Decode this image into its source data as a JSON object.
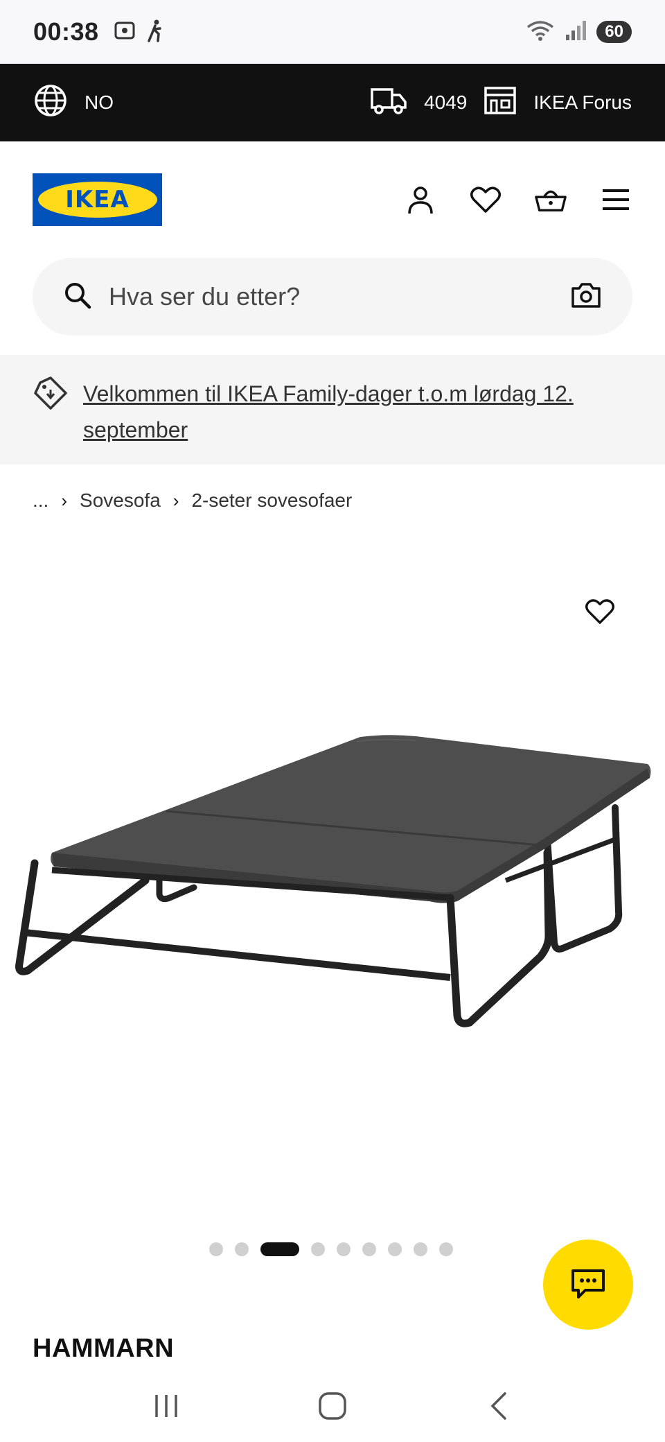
{
  "status_bar": {
    "time": "00:38",
    "battery": "60"
  },
  "top_bar": {
    "language": "NO",
    "postcode": "4049",
    "store": "IKEA Forus"
  },
  "header": {
    "logo_text": "IKEA",
    "brand_colors": {
      "blue": "#0051ba",
      "yellow": "#ffda1a"
    },
    "icons": [
      "profile-icon",
      "heart-icon",
      "basket-icon",
      "menu-icon"
    ]
  },
  "search": {
    "placeholder": "Hva ser du etter?"
  },
  "banner": {
    "text": "Velkommen til IKEA Family-dager t.o.m lørdag 12. september"
  },
  "breadcrumb": {
    "items": [
      "...",
      "Sovesofa",
      "2-seter sovesofaer"
    ]
  },
  "carousel": {
    "total": 9,
    "active_index": 2
  },
  "product": {
    "name": "HAMMARN"
  },
  "chat": {
    "color": "#ffdb00"
  }
}
